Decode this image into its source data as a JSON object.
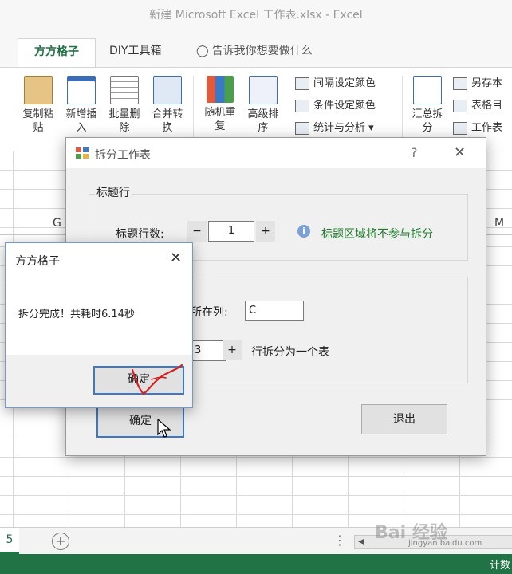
{
  "window": {
    "title": "新建 Microsoft Excel 工作表.xlsx - Excel"
  },
  "ribbon_tabs": {
    "active": "方方格子",
    "diy": "DIY工具箱",
    "tell_me": "告诉我你想要做什么"
  },
  "ribbon": {
    "copy_paste": "复制粘\n贴",
    "insert": "新增插\n入",
    "batch_delete": "批量删\n除",
    "merge_convert": "合并转\n换",
    "random_repeat": "随机重\n复",
    "advanced_sort": "高级排\n序",
    "interval_color": "间隔设定颜色",
    "condition_color": "条件设定颜色",
    "stats_analysis": "统计与分析",
    "summary_split": "汇总拆\n分",
    "save_as_this": "另存本",
    "table_dir": "表格目",
    "worksheet": "工作表"
  },
  "grid": {
    "col_g": "G",
    "col_m": "M"
  },
  "sheetbar": {
    "sheet_tab": "5",
    "add": "+",
    "dots": "⋮",
    "scroll_left": "◀"
  },
  "statusbar": {
    "right_text": "计数"
  },
  "watermark": {
    "logo": "Bai 经验",
    "url": "jingyan.baidu.com"
  },
  "dialog": {
    "title": "拆分工作表",
    "help": "?",
    "close": "✕",
    "group1_title": "标题行",
    "rows_label": "标题行数:",
    "minus": "−",
    "rows_value": "1",
    "plus": "+",
    "info_icon": "i",
    "info_text": "标题区域将不参与拆分",
    "col_label": "所在列:",
    "col_value": "C",
    "rows2_value": "3",
    "rows2_suffix": "行拆分为一个表",
    "ok": "确定",
    "exit": "退出"
  },
  "msgbox": {
    "title": "方方格子",
    "close": "✕",
    "text": "拆分完成！共耗时6.14秒",
    "ok": "确定"
  },
  "colors": {
    "excel_green": "#217346",
    "info_green": "#1f7a2c",
    "focus_blue": "#3c78c8",
    "scribble_red": "#d42020"
  }
}
